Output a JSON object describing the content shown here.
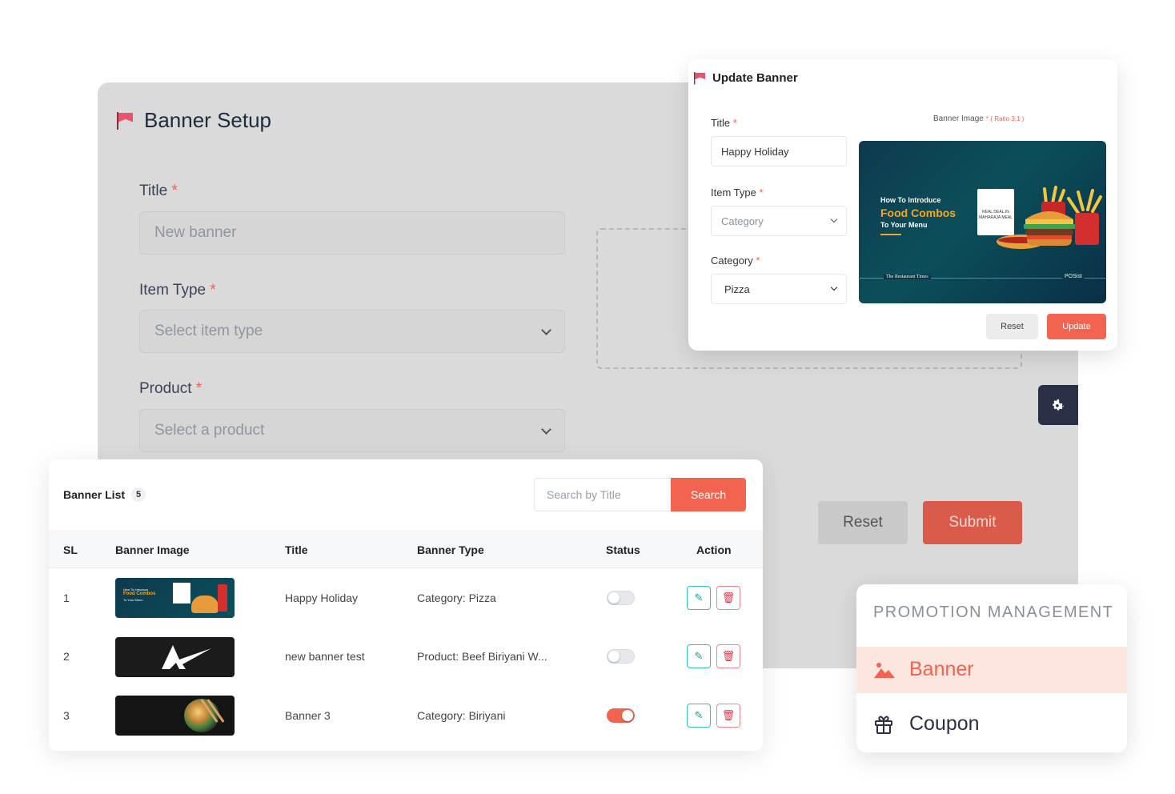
{
  "setup": {
    "title": "Banner Setup",
    "title_label": "Title",
    "title_placeholder": "New banner",
    "item_type_label": "Item Type",
    "item_type_placeholder": "Select item type",
    "product_label": "Product",
    "product_placeholder": "Select a product",
    "required_mark": "*",
    "reset_label": "Reset",
    "submit_label": "Submit"
  },
  "update": {
    "title": "Update Banner",
    "title_label": "Title",
    "title_value": "Happy Holiday",
    "item_type_label": "Item Type",
    "item_type_value": "Category",
    "category_label": "Category",
    "category_value": "Pizza",
    "image_label": "Banner Image",
    "ratio_note": "( Ratio 3:1 )",
    "required_mark": "*",
    "image": {
      "line1": "How To Introduce",
      "line2": "Food Combos",
      "line3": "To Your Menu",
      "badge": "REAL DEAL.IN MAHARAJA MEAL",
      "footer_left": "The Restaurant Times",
      "footer_right": "POSist"
    },
    "reset_label": "Reset",
    "update_label": "Update"
  },
  "list": {
    "title": "Banner List",
    "count": "5",
    "search_placeholder": "Search by Title",
    "search_label": "Search",
    "columns": [
      "SL",
      "Banner Image",
      "Title",
      "Banner Type",
      "Status",
      "Action"
    ],
    "rows": [
      {
        "sl": "1",
        "title": "Happy Holiday",
        "type": "Category: Pizza",
        "status": false
      },
      {
        "sl": "2",
        "title": "new banner test",
        "type": "Product: Beef Biriyani W...",
        "status": false
      },
      {
        "sl": "3",
        "title": "Banner 3",
        "type": "Category: Biriyani",
        "status": true
      }
    ]
  },
  "promotion": {
    "heading": "PROMOTION MANAGEMENT",
    "items": [
      {
        "label": "Banner",
        "icon": "image-icon",
        "active": true
      },
      {
        "label": "Coupon",
        "icon": "gift-icon",
        "active": false
      }
    ]
  },
  "colors": {
    "accent": "#f2644f",
    "edit": "#14a594",
    "delete": "#e0334b",
    "gear_button": "#2b3046"
  }
}
